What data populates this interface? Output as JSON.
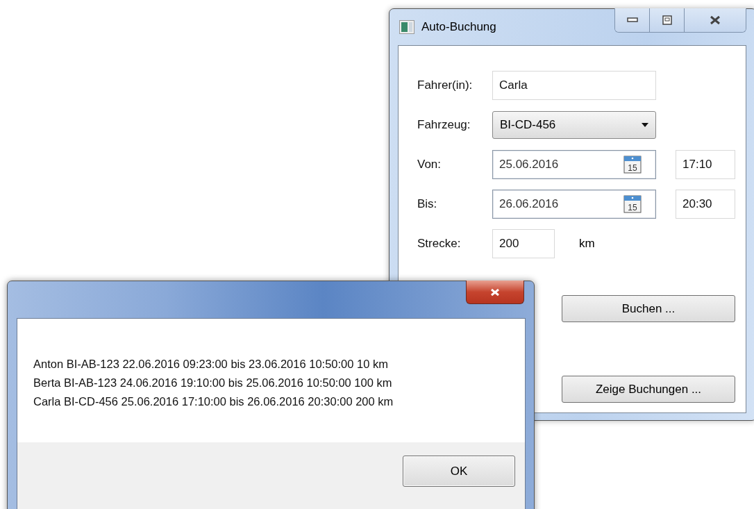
{
  "booking_window": {
    "title": "Auto-Buchung",
    "driver": {
      "label": "Fahrer(in):",
      "value": "Carla"
    },
    "vehicle": {
      "label": "Fahrzeug:",
      "value": "BI-CD-456"
    },
    "from": {
      "label": "Von:",
      "date": "25.06.2016",
      "calendar_day": "15",
      "time": "17:10"
    },
    "to": {
      "label": "Bis:",
      "date": "26.06.2016",
      "calendar_day": "15",
      "time": "20:30"
    },
    "distance": {
      "label": "Strecke:",
      "value": "200",
      "unit": "km"
    },
    "buttons": [
      "Buchen ...",
      "Zeige Buchungen ..."
    ]
  },
  "message_box": {
    "lines": [
      "Anton BI-AB-123 22.06.2016 09:23:00 bis 23.06.2016 10:50:00 10 km",
      "Berta BI-AB-123 24.06.2016 19:10:00 bis 25.06.2016 10:50:00 100 km",
      "Carla BI-CD-456 25.06.2016 17:10:00 bis 26.06.2016 20:30:00 200 km"
    ],
    "button": "OK"
  }
}
